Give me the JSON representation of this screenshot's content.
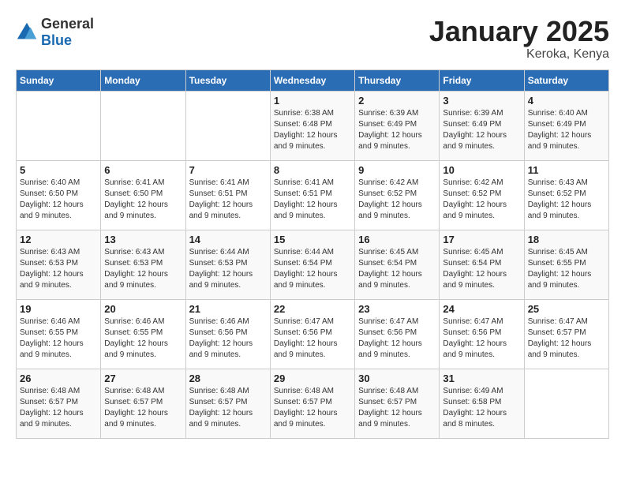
{
  "logo": {
    "text_general": "General",
    "text_blue": "Blue"
  },
  "title": "January 2025",
  "location": "Keroka, Kenya",
  "days_of_week": [
    "Sunday",
    "Monday",
    "Tuesday",
    "Wednesday",
    "Thursday",
    "Friday",
    "Saturday"
  ],
  "weeks": [
    [
      {
        "day": "",
        "info": ""
      },
      {
        "day": "",
        "info": ""
      },
      {
        "day": "",
        "info": ""
      },
      {
        "day": "1",
        "info": "Sunrise: 6:38 AM\nSunset: 6:48 PM\nDaylight: 12 hours and 9 minutes."
      },
      {
        "day": "2",
        "info": "Sunrise: 6:39 AM\nSunset: 6:49 PM\nDaylight: 12 hours and 9 minutes."
      },
      {
        "day": "3",
        "info": "Sunrise: 6:39 AM\nSunset: 6:49 PM\nDaylight: 12 hours and 9 minutes."
      },
      {
        "day": "4",
        "info": "Sunrise: 6:40 AM\nSunset: 6:49 PM\nDaylight: 12 hours and 9 minutes."
      }
    ],
    [
      {
        "day": "5",
        "info": "Sunrise: 6:40 AM\nSunset: 6:50 PM\nDaylight: 12 hours and 9 minutes."
      },
      {
        "day": "6",
        "info": "Sunrise: 6:41 AM\nSunset: 6:50 PM\nDaylight: 12 hours and 9 minutes."
      },
      {
        "day": "7",
        "info": "Sunrise: 6:41 AM\nSunset: 6:51 PM\nDaylight: 12 hours and 9 minutes."
      },
      {
        "day": "8",
        "info": "Sunrise: 6:41 AM\nSunset: 6:51 PM\nDaylight: 12 hours and 9 minutes."
      },
      {
        "day": "9",
        "info": "Sunrise: 6:42 AM\nSunset: 6:52 PM\nDaylight: 12 hours and 9 minutes."
      },
      {
        "day": "10",
        "info": "Sunrise: 6:42 AM\nSunset: 6:52 PM\nDaylight: 12 hours and 9 minutes."
      },
      {
        "day": "11",
        "info": "Sunrise: 6:43 AM\nSunset: 6:52 PM\nDaylight: 12 hours and 9 minutes."
      }
    ],
    [
      {
        "day": "12",
        "info": "Sunrise: 6:43 AM\nSunset: 6:53 PM\nDaylight: 12 hours and 9 minutes."
      },
      {
        "day": "13",
        "info": "Sunrise: 6:43 AM\nSunset: 6:53 PM\nDaylight: 12 hours and 9 minutes."
      },
      {
        "day": "14",
        "info": "Sunrise: 6:44 AM\nSunset: 6:53 PM\nDaylight: 12 hours and 9 minutes."
      },
      {
        "day": "15",
        "info": "Sunrise: 6:44 AM\nSunset: 6:54 PM\nDaylight: 12 hours and 9 minutes."
      },
      {
        "day": "16",
        "info": "Sunrise: 6:45 AM\nSunset: 6:54 PM\nDaylight: 12 hours and 9 minutes."
      },
      {
        "day": "17",
        "info": "Sunrise: 6:45 AM\nSunset: 6:54 PM\nDaylight: 12 hours and 9 minutes."
      },
      {
        "day": "18",
        "info": "Sunrise: 6:45 AM\nSunset: 6:55 PM\nDaylight: 12 hours and 9 minutes."
      }
    ],
    [
      {
        "day": "19",
        "info": "Sunrise: 6:46 AM\nSunset: 6:55 PM\nDaylight: 12 hours and 9 minutes."
      },
      {
        "day": "20",
        "info": "Sunrise: 6:46 AM\nSunset: 6:55 PM\nDaylight: 12 hours and 9 minutes."
      },
      {
        "day": "21",
        "info": "Sunrise: 6:46 AM\nSunset: 6:56 PM\nDaylight: 12 hours and 9 minutes."
      },
      {
        "day": "22",
        "info": "Sunrise: 6:47 AM\nSunset: 6:56 PM\nDaylight: 12 hours and 9 minutes."
      },
      {
        "day": "23",
        "info": "Sunrise: 6:47 AM\nSunset: 6:56 PM\nDaylight: 12 hours and 9 minutes."
      },
      {
        "day": "24",
        "info": "Sunrise: 6:47 AM\nSunset: 6:56 PM\nDaylight: 12 hours and 9 minutes."
      },
      {
        "day": "25",
        "info": "Sunrise: 6:47 AM\nSunset: 6:57 PM\nDaylight: 12 hours and 9 minutes."
      }
    ],
    [
      {
        "day": "26",
        "info": "Sunrise: 6:48 AM\nSunset: 6:57 PM\nDaylight: 12 hours and 9 minutes."
      },
      {
        "day": "27",
        "info": "Sunrise: 6:48 AM\nSunset: 6:57 PM\nDaylight: 12 hours and 9 minutes."
      },
      {
        "day": "28",
        "info": "Sunrise: 6:48 AM\nSunset: 6:57 PM\nDaylight: 12 hours and 9 minutes."
      },
      {
        "day": "29",
        "info": "Sunrise: 6:48 AM\nSunset: 6:57 PM\nDaylight: 12 hours and 9 minutes."
      },
      {
        "day": "30",
        "info": "Sunrise: 6:48 AM\nSunset: 6:57 PM\nDaylight: 12 hours and 9 minutes."
      },
      {
        "day": "31",
        "info": "Sunrise: 6:49 AM\nSunset: 6:58 PM\nDaylight: 12 hours and 8 minutes."
      },
      {
        "day": "",
        "info": ""
      }
    ]
  ]
}
